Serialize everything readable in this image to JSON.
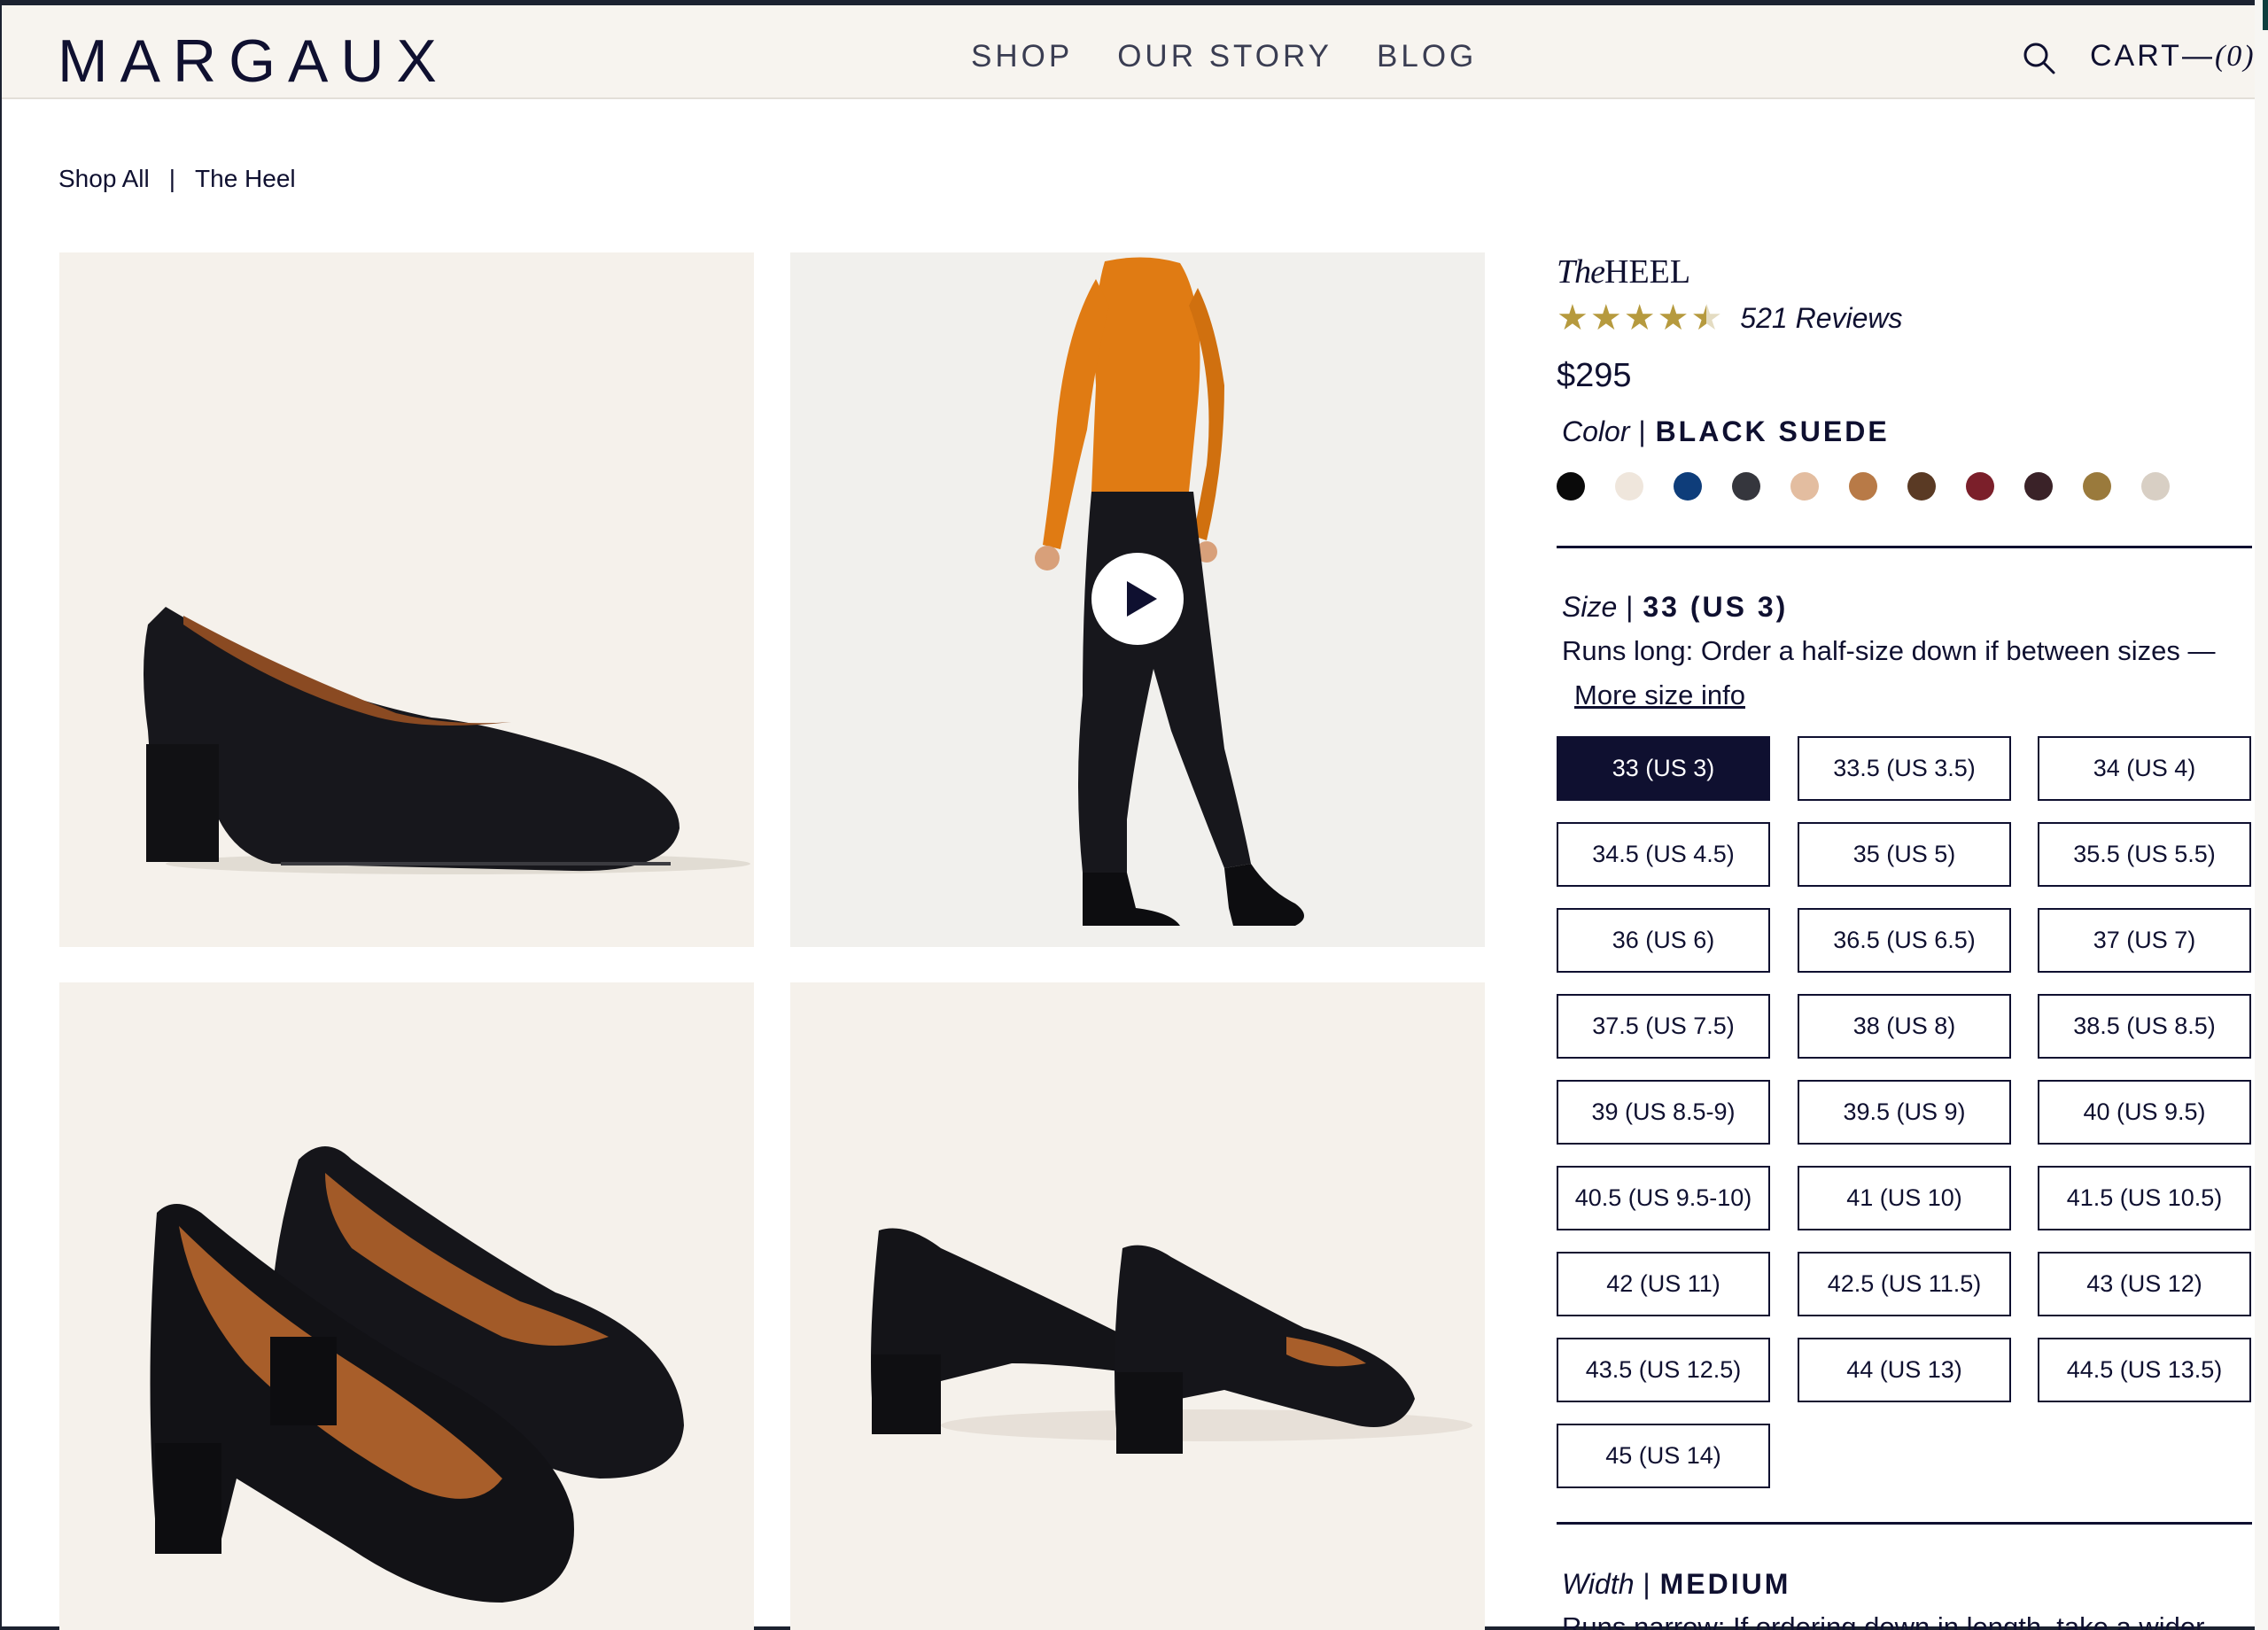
{
  "header": {
    "logo": "MARGAUX",
    "nav": [
      "SHOP",
      "OUR STORY",
      "BLOG"
    ],
    "cart_label": "CART—",
    "cart_count": "(0)"
  },
  "breadcrumb": {
    "items": [
      "Shop All",
      "The Heel"
    ],
    "separator": "|"
  },
  "product": {
    "title_prefix": "The",
    "title": "HEEL",
    "rating": 4.5,
    "reviews": "521 Reviews",
    "price": "$295",
    "color": {
      "label": "Color",
      "separator": "|",
      "value": "BLACK SUEDE",
      "swatches": [
        "#0a0a0a",
        "#efe6dc",
        "#0e3d7a",
        "#35363d",
        "#e3bda0",
        "#b87a47",
        "#5a3a24",
        "#7b1f2a",
        "#3a2228",
        "#9a7a3c",
        "#d8cfc4"
      ]
    },
    "size": {
      "label": "Size",
      "separator": "|",
      "value": "33 (US 3)",
      "note": "Runs long: Order a half-size down if between sizes —",
      "more_link": "More size info",
      "options": [
        "33 (US 3)",
        "33.5 (US 3.5)",
        "34 (US 4)",
        "34.5 (US 4.5)",
        "35 (US 5)",
        "35.5 (US 5.5)",
        "36 (US 6)",
        "36.5 (US 6.5)",
        "37 (US 7)",
        "37.5 (US 7.5)",
        "38 (US 8)",
        "38.5 (US 8.5)",
        "39 (US 8.5-9)",
        "39.5 (US 9)",
        "40 (US 9.5)",
        "40.5 (US 9.5-10)",
        "41 (US 10)",
        "41.5 (US 10.5)",
        "42 (US 11)",
        "42.5 (US 11.5)",
        "43 (US 12)",
        "43.5 (US 12.5)",
        "44 (US 13)",
        "44.5 (US 13.5)",
        "45 (US 14)"
      ],
      "selected": "33 (US 3)"
    },
    "width": {
      "label": "Width",
      "separator": "|",
      "value": "MEDIUM",
      "note": "Runs narrow: If ordering down in length, take a wider"
    }
  },
  "icons": {
    "search": "search-icon",
    "play": "play-icon",
    "star": "star-icon"
  }
}
